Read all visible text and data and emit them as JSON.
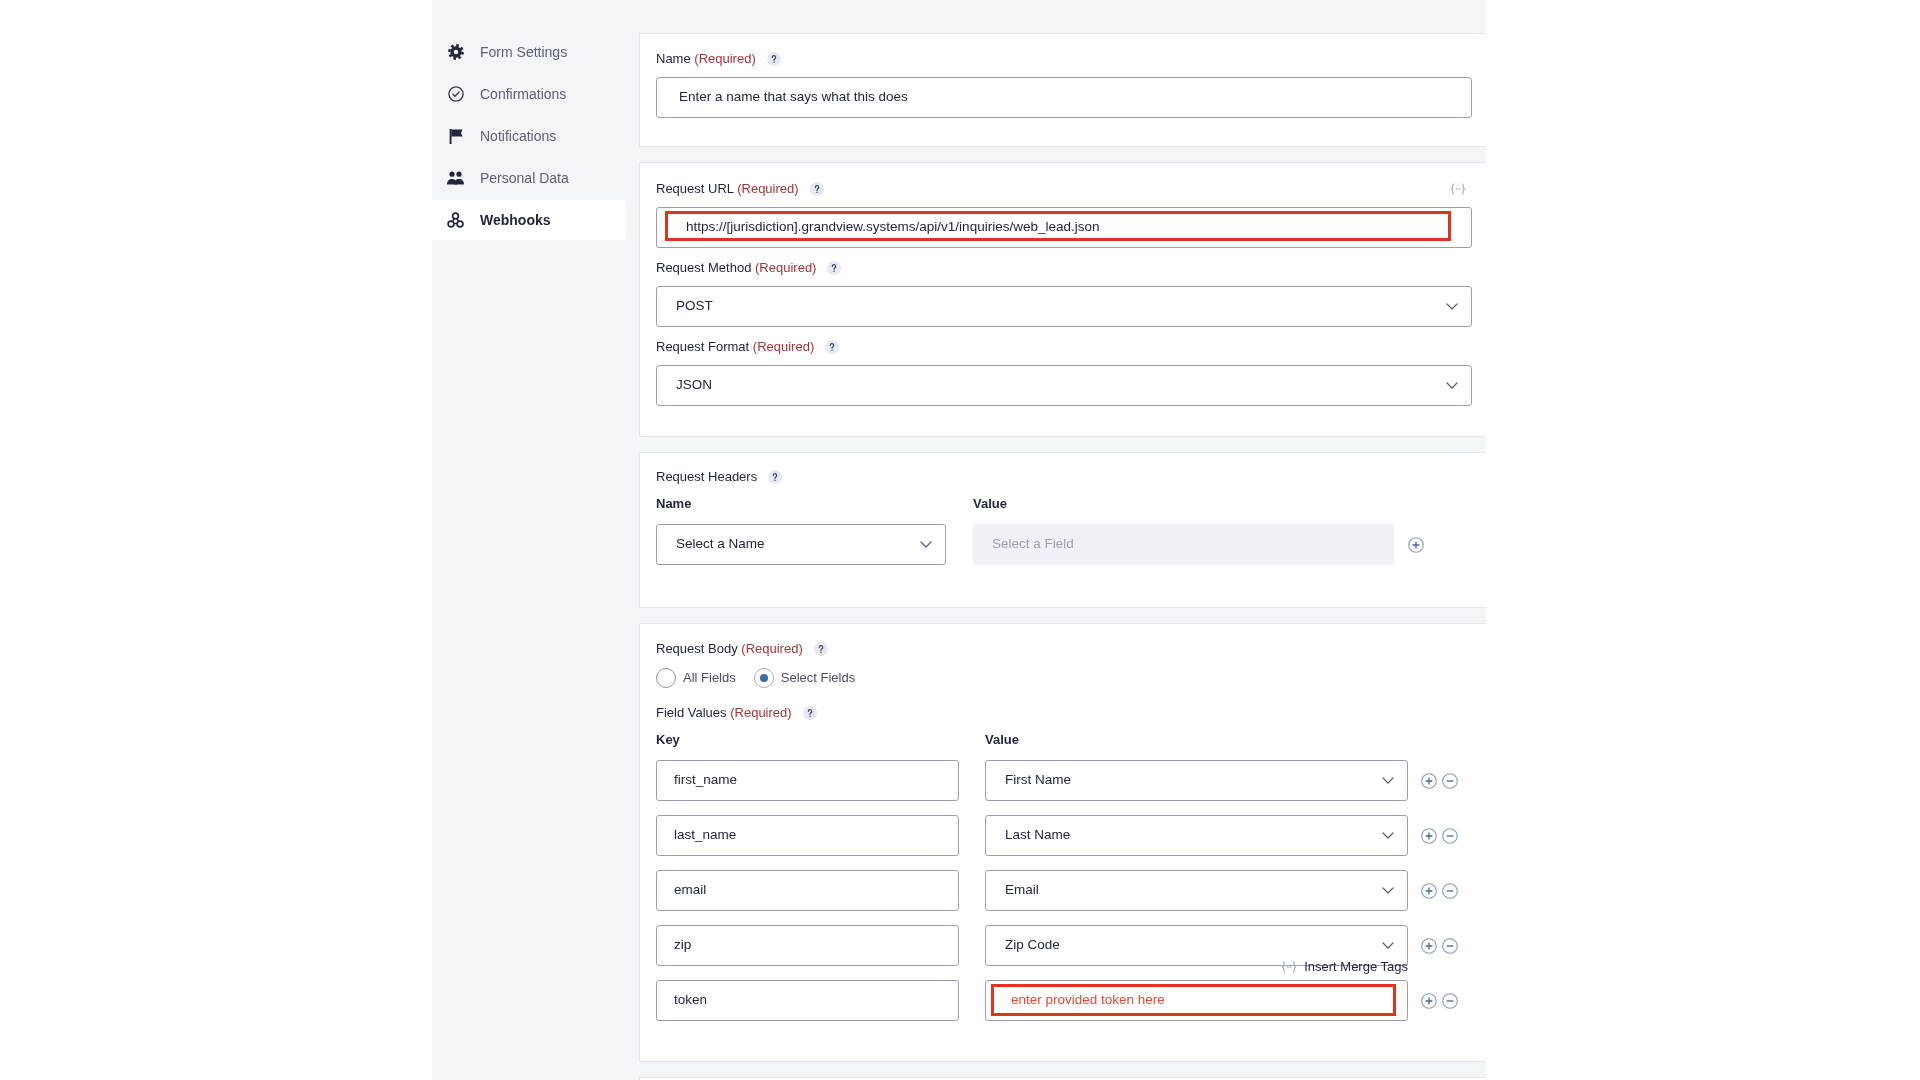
{
  "sidebar": {
    "items": [
      {
        "label": "Form Settings",
        "selected": false
      },
      {
        "label": "Confirmations",
        "selected": false
      },
      {
        "label": "Notifications",
        "selected": false
      },
      {
        "label": "Personal Data",
        "selected": false
      },
      {
        "label": "Webhooks",
        "selected": true
      }
    ]
  },
  "name_panel": {
    "label": "Name",
    "required": "(Required)",
    "value": "Enter a name that says what this does"
  },
  "request_panel": {
    "url": {
      "label": "Request URL",
      "required": "(Required)",
      "value": "https://[jurisdiction].grandview.systems/api/v1/inquiries/web_lead.json",
      "highlighted": true
    },
    "method": {
      "label": "Request Method",
      "required": "(Required)",
      "value": "POST"
    },
    "format": {
      "label": "Request Format",
      "required": "(Required)",
      "value": "JSON"
    }
  },
  "headers_panel": {
    "label": "Request Headers",
    "columns": [
      "Name",
      "Value"
    ],
    "rows": [
      {
        "name": "Select a Name",
        "value": {
          "placeholder": "Select a Field",
          "disabled": true
        }
      }
    ]
  },
  "body_panel": {
    "label": "Request Body",
    "required": "(Required)",
    "options": [
      {
        "label": "All Fields",
        "selected": false
      },
      {
        "label": "Select Fields",
        "selected": true
      }
    ],
    "field_values": {
      "label": "Field Values",
      "required": "(Required)",
      "columns": [
        "Key",
        "Value"
      ],
      "rows": [
        {
          "key": "first_name",
          "value": "First Name",
          "kind": "select",
          "highlighted": false
        },
        {
          "key": "last_name",
          "value": "Last Name",
          "kind": "select",
          "highlighted": false
        },
        {
          "key": "email",
          "value": "Email",
          "kind": "select",
          "highlighted": false
        },
        {
          "key": "zip",
          "value": "Zip Code",
          "kind": "select",
          "highlighted": false
        },
        {
          "key": "token",
          "value": "enter provided token here",
          "kind": "text",
          "highlighted": true,
          "merge_tags": "Insert Merge Tags"
        }
      ]
    }
  }
}
